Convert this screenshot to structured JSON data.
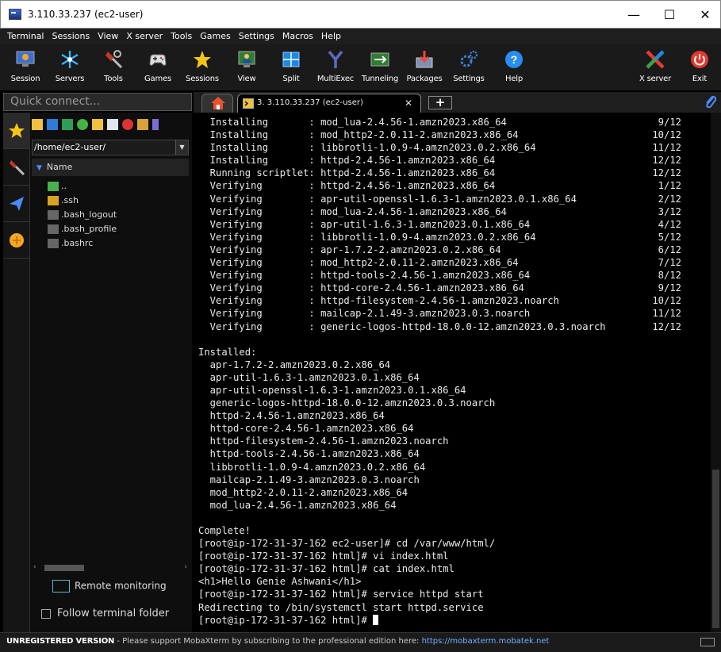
{
  "window": {
    "title": "3.110.33.237 (ec2-user)",
    "minimize": "—",
    "maximize": "☐",
    "close": "✕"
  },
  "menu": [
    "Terminal",
    "Sessions",
    "View",
    "X server",
    "Tools",
    "Games",
    "Settings",
    "Macros",
    "Help"
  ],
  "toolbar": {
    "session": "Session",
    "servers": "Servers",
    "tools": "Tools",
    "games": "Games",
    "sessions": "Sessions",
    "view": "View",
    "split": "Split",
    "multiexec": "MultiExec",
    "tunneling": "Tunneling",
    "packages": "Packages",
    "settings": "Settings",
    "help": "Help",
    "xserver": "X server",
    "exit": "Exit"
  },
  "quick_connect_placeholder": "Quick connect...",
  "tabs": {
    "session_label": "3. 3.110.33.237 (ec2-user)",
    "close": "✕",
    "new": "+"
  },
  "sidebar": {
    "path": "/home/ec2-user/",
    "tree_header": "Name",
    "files": [
      "..",
      ".ssh",
      ".bash_logout",
      ".bash_profile",
      ".bashrc"
    ],
    "remote_monitoring": "Remote monitoring",
    "follow_terminal": "Follow terminal folder"
  },
  "terminal": {
    "lines": [
      "  Installing       : mod_lua-2.4.56-1.amzn2023.x86_64                          9/12",
      "  Installing       : mod_http2-2.0.11-2.amzn2023.x86_64                       10/12",
      "  Installing       : libbrotli-1.0.9-4.amzn2023.0.2.x86_64                    11/12",
      "  Installing       : httpd-2.4.56-1.amzn2023.x86_64                           12/12",
      "  Running scriptlet: httpd-2.4.56-1.amzn2023.x86_64                           12/12",
      "  Verifying        : httpd-2.4.56-1.amzn2023.x86_64                            1/12",
      "  Verifying        : apr-util-openssl-1.6.3-1.amzn2023.0.1.x86_64              2/12",
      "  Verifying        : mod_lua-2.4.56-1.amzn2023.x86_64                          3/12",
      "  Verifying        : apr-util-1.6.3-1.amzn2023.0.1.x86_64                      4/12",
      "  Verifying        : libbrotli-1.0.9-4.amzn2023.0.2.x86_64                     5/12",
      "  Verifying        : apr-1.7.2-2.amzn2023.0.2.x86_64                           6/12",
      "  Verifying        : mod_http2-2.0.11-2.amzn2023.x86_64                        7/12",
      "  Verifying        : httpd-tools-2.4.56-1.amzn2023.x86_64                      8/12",
      "  Verifying        : httpd-core-2.4.56-1.amzn2023.x86_64                       9/12",
      "  Verifying        : httpd-filesystem-2.4.56-1.amzn2023.noarch                10/12",
      "  Verifying        : mailcap-2.1.49-3.amzn2023.0.3.noarch                     11/12",
      "  Verifying        : generic-logos-httpd-18.0.0-12.amzn2023.0.3.noarch        12/12",
      "",
      "Installed:",
      "  apr-1.7.2-2.amzn2023.0.2.x86_64",
      "  apr-util-1.6.3-1.amzn2023.0.1.x86_64",
      "  apr-util-openssl-1.6.3-1.amzn2023.0.1.x86_64",
      "  generic-logos-httpd-18.0.0-12.amzn2023.0.3.noarch",
      "  httpd-2.4.56-1.amzn2023.x86_64",
      "  httpd-core-2.4.56-1.amzn2023.x86_64",
      "  httpd-filesystem-2.4.56-1.amzn2023.noarch",
      "  httpd-tools-2.4.56-1.amzn2023.x86_64",
      "  libbrotli-1.0.9-4.amzn2023.0.2.x86_64",
      "  mailcap-2.1.49-3.amzn2023.0.3.noarch",
      "  mod_http2-2.0.11-2.amzn2023.x86_64",
      "  mod_lua-2.4.56-1.amzn2023.x86_64",
      "",
      "Complete!",
      "[root@ip-172-31-37-162 ec2-user]# cd /var/www/html/",
      "[root@ip-172-31-37-162 html]# vi index.html",
      "[root@ip-172-31-37-162 html]# cat index.html",
      "<h1>Hello Genie Ashwani</h1>",
      "[root@ip-172-31-37-162 html]# service httpd start",
      "Redirecting to /bin/systemctl start httpd.service"
    ],
    "prompt": "[root@ip-172-31-37-162 html]# "
  },
  "status": {
    "unregistered": "UNREGISTERED VERSION",
    "message": "  -  Please support MobaXterm by subscribing to the professional edition here:  ",
    "link": "https://mobaxterm.mobatek.net"
  },
  "colors": {
    "link": "#6fb0ff",
    "accent": "#4a8cff",
    "exit_red": "#e03a2f",
    "help_blue": "#2a8cf0"
  }
}
